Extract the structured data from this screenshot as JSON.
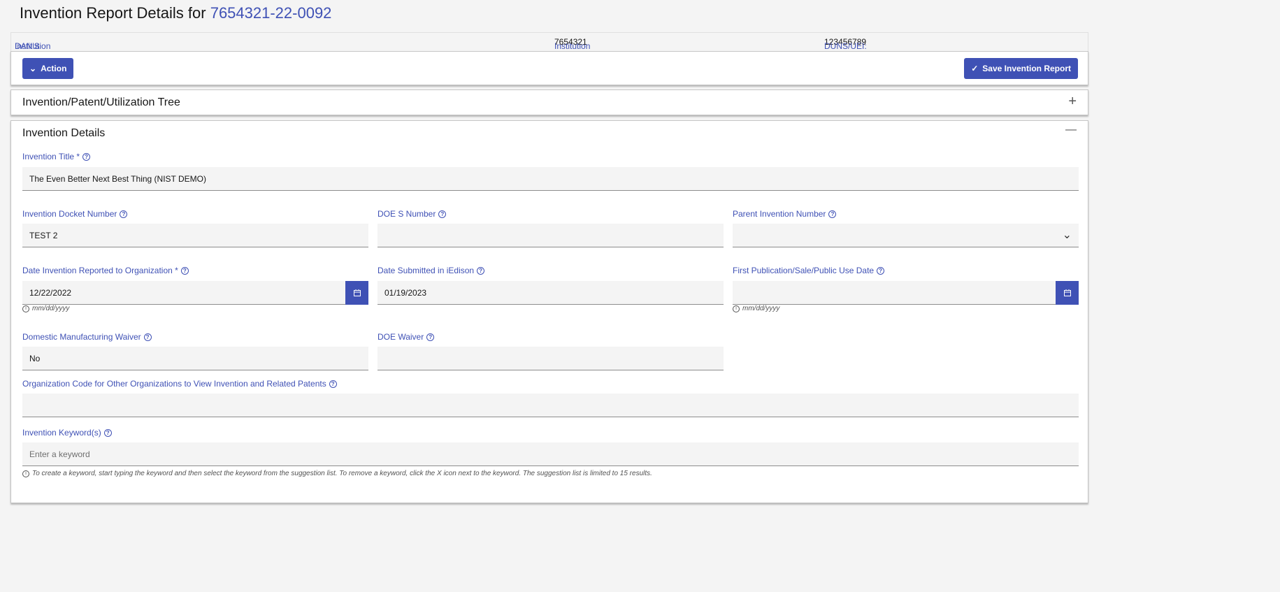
{
  "header": {
    "title_prefix": "Invention Report Details for",
    "report_number": "7654321-22-0092"
  },
  "info": {
    "institution_name_label": "Institution Name:",
    "institution_name": "DAN'S INSTITUTION",
    "institution_code_label": "Institution Code:",
    "institution_code": "7654321",
    "duns_label": "DUNS/UEI:",
    "duns": "123456789"
  },
  "toolbar": {
    "action_label": "Action",
    "save_label": "Save Invention Report"
  },
  "tree_panel": {
    "title": "Invention/Patent/Utilization Tree",
    "toggle": "+"
  },
  "details_panel": {
    "title": "Invention Details",
    "toggle": "—"
  },
  "fields": {
    "title": {
      "label": "Invention Title *",
      "value": "The Even Better Next Best Thing (NIST DEMO)"
    },
    "docket": {
      "label": "Invention Docket Number",
      "value": "TEST 2"
    },
    "doe_s": {
      "label": "DOE S Number",
      "value": ""
    },
    "parent": {
      "label": "Parent Invention Number",
      "value": ""
    },
    "date_reported": {
      "label": "Date Invention Reported to Organization *",
      "value": "12/22/2022",
      "hint": "mm/dd/yyyy"
    },
    "date_submitted": {
      "label": "Date Submitted in iEdison",
      "value": "01/19/2023"
    },
    "first_pub": {
      "label": "First Publication/Sale/Public Use Date",
      "value": "",
      "hint": "mm/dd/yyyy"
    },
    "dom_waiver": {
      "label": "Domestic Manufacturing Waiver",
      "value": "No"
    },
    "doe_waiver": {
      "label": "DOE Waiver",
      "value": ""
    },
    "org_code": {
      "label": "Organization Code for Other Organizations to View Invention and Related Patents",
      "value": ""
    },
    "keywords": {
      "label": "Invention Keyword(s)",
      "placeholder": "Enter a keyword",
      "hint": "To create a keyword, start typing the keyword and then select the keyword from the suggestion list. To remove a keyword, click the X icon next to the keyword. The suggestion list is limited to 15 results."
    }
  }
}
